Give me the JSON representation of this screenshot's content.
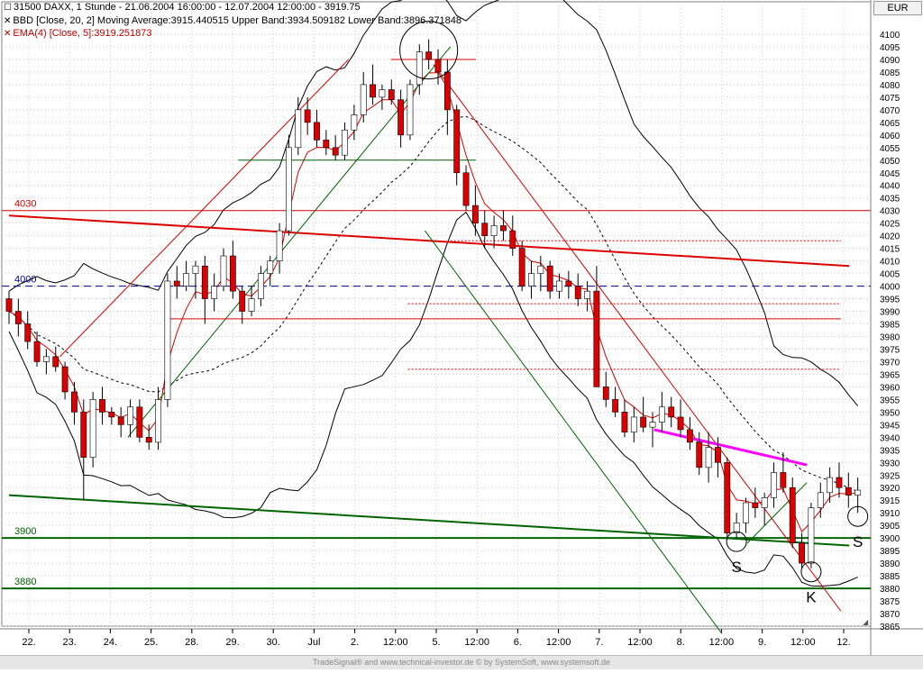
{
  "header": {
    "line1": "31500  DAXX, 1 Stunde - 21.06.2004 16:00:00 - 12.07.2004 12:00:00 - 3919.75",
    "line2": "BBD [Close, 20, 2] Moving Average:3915.440515 Upper Band:3934.509182 Lower Band:3896.371848",
    "line3": "EMA(4) [Close, 5]:3919.251873",
    "currency": "EUR"
  },
  "footer": {
    "text": "TradeSignal® and www.technical-investor.de © by SystemSoft, www.systemsoft.de"
  },
  "colors": {
    "candle_up": "#ffffff",
    "candle_down": "#dd0000",
    "ema": "#dd0000",
    "bands": "#000000",
    "support_green": "#006400",
    "resistance_red": "#dd0000",
    "pink": "#ff00ff",
    "blue_dash": "#000099"
  },
  "chart_data": {
    "type": "candlestick",
    "title": "31500  DAXX, 1 Stunde",
    "y_axis": {
      "min": 3865,
      "max": 4100,
      "step": 5,
      "side": "right"
    },
    "x_labels": [
      "22.",
      "23.",
      "24.",
      "25.",
      "28.",
      "29.",
      "30.",
      "Jul",
      "2.",
      "12:00",
      "5.",
      "12:00",
      "6.",
      "12:00",
      "7.",
      "12:00",
      "8.",
      "12:00",
      "9.",
      "12:00",
      "12."
    ],
    "ohlc": [
      [
        3995,
        3998,
        3985,
        3990
      ],
      [
        3990,
        3995,
        3980,
        3985
      ],
      [
        3985,
        3990,
        3975,
        3978
      ],
      [
        3978,
        3982,
        3968,
        3970
      ],
      [
        3970,
        3975,
        3965,
        3972
      ],
      [
        3972,
        3976,
        3966,
        3968
      ],
      [
        3968,
        3970,
        3955,
        3958
      ],
      [
        3958,
        3962,
        3945,
        3950
      ],
      [
        3950,
        3955,
        3915,
        3932
      ],
      [
        3932,
        3958,
        3928,
        3955
      ],
      [
        3955,
        3960,
        3945,
        3950
      ],
      [
        3950,
        3952,
        3945,
        3948
      ],
      [
        3948,
        3952,
        3940,
        3945
      ],
      [
        3945,
        3955,
        3940,
        3952
      ],
      [
        3952,
        3955,
        3938,
        3940
      ],
      [
        3940,
        3945,
        3935,
        3938
      ],
      [
        3938,
        3960,
        3935,
        3955
      ],
      [
        3955,
        4005,
        3952,
        4002
      ],
      [
        4002,
        4008,
        3995,
        4000
      ],
      [
        4000,
        4010,
        3998,
        4005
      ],
      [
        4005,
        4010,
        3995,
        4008
      ],
      [
        4008,
        4012,
        3985,
        3995
      ],
      [
        3995,
        4005,
        3990,
        4000
      ],
      [
        4000,
        4015,
        3998,
        4012
      ],
      [
        4012,
        4018,
        3995,
        3998
      ],
      [
        3998,
        4000,
        3985,
        3990
      ],
      [
        3990,
        4000,
        3988,
        3995
      ],
      [
        3995,
        4008,
        3992,
        4005
      ],
      [
        4005,
        4012,
        4000,
        4010
      ],
      [
        4010,
        4025,
        4005,
        4022
      ],
      [
        4022,
        4060,
        4020,
        4055
      ],
      [
        4055,
        4075,
        4052,
        4070
      ],
      [
        4070,
        4075,
        4060,
        4065
      ],
      [
        4065,
        4070,
        4055,
        4058
      ],
      [
        4058,
        4062,
        4052,
        4055
      ],
      [
        4055,
        4060,
        4050,
        4052
      ],
      [
        4052,
        4065,
        4050,
        4062
      ],
      [
        4062,
        4072,
        4058,
        4068
      ],
      [
        4068,
        4085,
        4065,
        4080
      ],
      [
        4080,
        4088,
        4072,
        4075
      ],
      [
        4075,
        4080,
        4070,
        4078
      ],
      [
        4078,
        4082,
        4072,
        4074
      ],
      [
        4074,
        4078,
        4055,
        4060
      ],
      [
        4060,
        4082,
        4058,
        4080
      ],
      [
        4080,
        4096,
        4076,
        4093
      ],
      [
        4093,
        4098,
        4086,
        4090
      ],
      [
        4090,
        4094,
        4080,
        4085
      ],
      [
        4085,
        4090,
        4060,
        4070
      ],
      [
        4070,
        4072,
        4040,
        4045
      ],
      [
        4045,
        4048,
        4030,
        4032
      ],
      [
        4032,
        4040,
        4020,
        4025
      ],
      [
        4025,
        4030,
        4015,
        4020
      ],
      [
        4020,
        4028,
        4015,
        4024
      ],
      [
        4024,
        4030,
        4018,
        4022
      ],
      [
        4022,
        4028,
        4012,
        4015
      ],
      [
        4015,
        4018,
        3998,
        4000
      ],
      [
        4000,
        4010,
        3995,
        4005
      ],
      [
        4005,
        4012,
        3998,
        4008
      ],
      [
        4008,
        4010,
        3995,
        3998
      ],
      [
        3998,
        4005,
        3995,
        4002
      ],
      [
        4002,
        4006,
        3995,
        4000
      ],
      [
        4000,
        4005,
        3992,
        3995
      ],
      [
        3995,
        4002,
        3990,
        3998
      ],
      [
        3998,
        4008,
        3990,
        3960
      ],
      [
        3960,
        3966,
        3952,
        3955
      ],
      [
        3955,
        3960,
        3948,
        3950
      ],
      [
        3950,
        3955,
        3940,
        3942
      ],
      [
        3942,
        3952,
        3938,
        3948
      ],
      [
        3948,
        3956,
        3942,
        3944
      ],
      [
        3944,
        3950,
        3936,
        3946
      ],
      [
        3946,
        3958,
        3942,
        3952
      ],
      [
        3952,
        3956,
        3944,
        3948
      ],
      [
        3948,
        3955,
        3940,
        3943
      ],
      [
        3943,
        3948,
        3935,
        3938
      ],
      [
        3938,
        3942,
        3925,
        3928
      ],
      [
        3928,
        3942,
        3922,
        3936
      ],
      [
        3936,
        3940,
        3924,
        3930
      ],
      [
        3930,
        3932,
        3900,
        3902
      ],
      [
        3902,
        3910,
        3900,
        3906
      ],
      [
        3906,
        3916,
        3902,
        3914
      ],
      [
        3914,
        3920,
        3908,
        3912
      ],
      [
        3912,
        3918,
        3905,
        3916
      ],
      [
        3916,
        3930,
        3912,
        3926
      ],
      [
        3926,
        3934,
        3918,
        3920
      ],
      [
        3920,
        3924,
        3896,
        3898
      ],
      [
        3898,
        3902,
        3888,
        3890
      ],
      [
        3890,
        3914,
        3888,
        3912
      ],
      [
        3912,
        3922,
        3908,
        3918
      ],
      [
        3918,
        3928,
        3914,
        3924
      ],
      [
        3924,
        3930,
        3916,
        3920
      ],
      [
        3920,
        3926,
        3912,
        3917
      ],
      [
        3917,
        3924,
        3910,
        3919
      ]
    ],
    "indicators": [
      {
        "name": "BBD [Close, 20, 2]",
        "moving_average": 3915.440515,
        "upper_band": 3934.509182,
        "lower_band": 3896.371848
      },
      {
        "name": "EMA(4) [Close, 5]",
        "value": 3919.251873
      }
    ],
    "horizontal_levels": [
      {
        "value": 4030,
        "label": "4030"
      },
      {
        "value": 4000,
        "label": "4000"
      },
      {
        "value": 3900,
        "label": "3900"
      },
      {
        "value": 3880,
        "label": "3880"
      }
    ],
    "annotations": [
      {
        "label": "S",
        "x_index": 78
      },
      {
        "label": "K",
        "x_index": 86
      },
      {
        "label": "S",
        "x_index": 94
      }
    ]
  }
}
